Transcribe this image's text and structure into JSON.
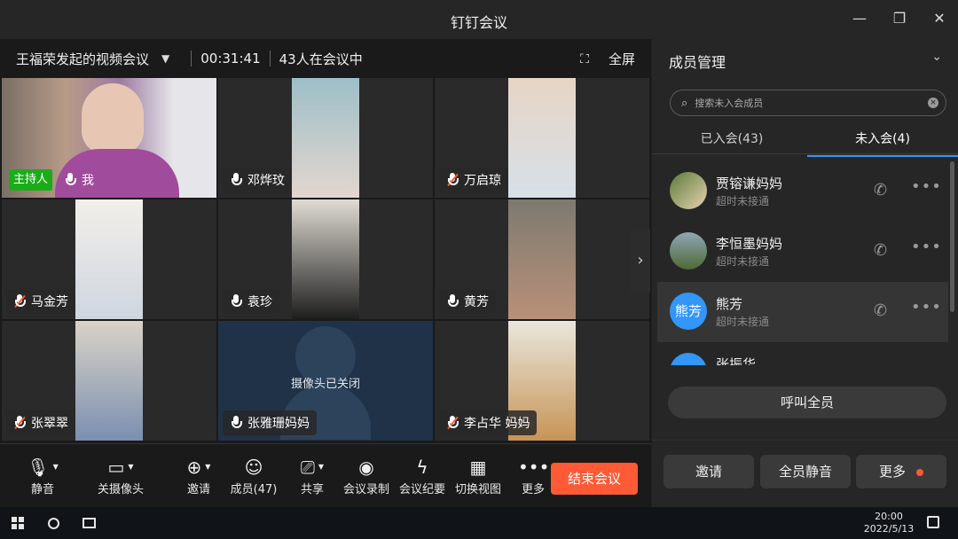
{
  "window": {
    "title": "钉钉会议",
    "min_icon": "minimize-icon",
    "max_icon": "restore-icon",
    "close_icon": "close-icon"
  },
  "meeting": {
    "name": "王福荣发起的视频会议",
    "duration": "00:31:41",
    "attendance": "43人在会议中",
    "fullscreen_label": "全屏"
  },
  "tiles": [
    {
      "label": "我",
      "host_badge": "主持人",
      "mic": "on"
    },
    {
      "label": "邓烨玟",
      "mic": "on"
    },
    {
      "label": "万启琼",
      "mic": "muted"
    },
    {
      "label": "马金芳",
      "mic": "muted"
    },
    {
      "label": "袁珍",
      "mic": "on"
    },
    {
      "label": "黄芳",
      "mic": "on"
    },
    {
      "label": "张翠翠",
      "mic": "muted"
    },
    {
      "label": "张雅珊妈妈",
      "mic": "on",
      "camera_off_text": "摄像头已关闭"
    },
    {
      "label": "李占华 妈妈",
      "mic": "muted"
    }
  ],
  "toolbar": {
    "mute": "静音",
    "camera_off": "关摄像头",
    "invite": "邀请",
    "members": "成员(47)",
    "share": "共享",
    "record": "会议录制",
    "minutes": "会议纪要",
    "switch_view": "切换视图",
    "more": "更多",
    "end": "结束会议"
  },
  "members_panel": {
    "title": "成员管理",
    "search_placeholder": "搜索未入会成员",
    "tab_joined": "已入会(43)",
    "tab_not_joined": "未入会(4)",
    "members": [
      {
        "name": "贾镕谦妈妈",
        "status": "超时未接通"
      },
      {
        "name": "李恒墨妈妈",
        "status": "超时未接通"
      },
      {
        "name": "熊芳",
        "status": "超时未接通",
        "avatar_text": "熊芳"
      },
      {
        "name": "张振华",
        "status": ""
      }
    ],
    "call_all": "呼叫全员",
    "invite": "邀请",
    "mute_all": "全员静音",
    "more": "更多"
  },
  "taskbar": {
    "time": "20:00",
    "date": "2022/5/13"
  },
  "colors": {
    "accent": "#3296fa",
    "end": "#ff5a36",
    "host": "#1aad19"
  }
}
